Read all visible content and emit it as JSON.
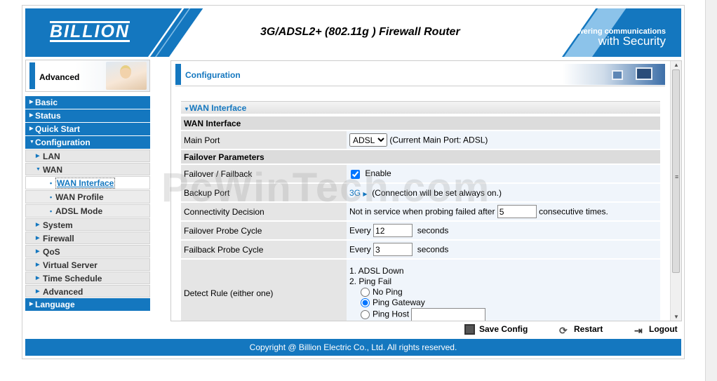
{
  "header": {
    "logo": "BILLION",
    "title": "3G/ADSL2+ (802.11g ) Firewall Router",
    "powering_line1": "Powering communications",
    "powering_line2": "with Security"
  },
  "sidebar": {
    "section_label": "Advanced",
    "items": [
      {
        "label": "Basic",
        "level": "main"
      },
      {
        "label": "Status",
        "level": "main"
      },
      {
        "label": "Quick Start",
        "level": "main"
      },
      {
        "label": "Configuration",
        "level": "main",
        "expanded": true
      },
      {
        "label": "LAN",
        "level": "sub"
      },
      {
        "label": "WAN",
        "level": "sub",
        "expanded": true
      },
      {
        "label": "WAN Interface",
        "level": "sub2",
        "active": true
      },
      {
        "label": "WAN Profile",
        "level": "sub2"
      },
      {
        "label": "ADSL Mode",
        "level": "sub2"
      },
      {
        "label": "System",
        "level": "sub"
      },
      {
        "label": "Firewall",
        "level": "sub"
      },
      {
        "label": "QoS",
        "level": "sub"
      },
      {
        "label": "Virtual Server",
        "level": "sub"
      },
      {
        "label": "Time Schedule",
        "level": "sub"
      },
      {
        "label": "Advanced",
        "level": "sub"
      },
      {
        "label": "Language",
        "level": "main"
      }
    ]
  },
  "content": {
    "header_title": "Configuration",
    "section_title": "WAN Interface",
    "group1_title": "WAN Interface",
    "main_port_label": "Main Port",
    "main_port_value": "ADSL",
    "main_port_note": "(Current Main Port: ADSL)",
    "group2_title": "Failover Parameters",
    "failover_label": "Failover / Failback",
    "failover_enable_label": "Enable",
    "failover_enabled": true,
    "backup_port_label": "Backup Port",
    "backup_port_value": "3G",
    "backup_port_note": "(Connection will be set always on.)",
    "connectivity_label": "Connectivity Decision",
    "connectivity_prefix": "Not in service when probing failed after",
    "connectivity_value": "5",
    "connectivity_suffix": "consecutive times.",
    "failover_probe_label": "Failover Probe Cycle",
    "failover_probe_prefix": "Every",
    "failover_probe_value": "12",
    "failover_probe_suffix": "seconds",
    "failback_probe_label": "Failback Probe Cycle",
    "failback_probe_prefix": "Every",
    "failback_probe_value": "3",
    "failback_probe_suffix": "seconds",
    "detect_rule_label": "Detect Rule (either one)",
    "detect_line1": "1. ADSL Down",
    "detect_line2": "2. Ping Fail",
    "radio_no_ping": "No Ping",
    "radio_ping_gateway": "Ping Gateway",
    "radio_ping_host": "Ping Host",
    "ping_host_value": ""
  },
  "actions": {
    "save": "Save Config",
    "restart": "Restart",
    "logout": "Logout"
  },
  "footer": {
    "copyright": "Copyright @ Billion Electric Co., Ltd. All rights reserved."
  },
  "watermark": "PcWinTech.com",
  "colors": {
    "brand_blue": "#1477bf",
    "row_label_bg": "#e5e5e5",
    "row_value_bg": "#f0f5fb"
  },
  "icons": {
    "save": "floppy-disk-icon",
    "restart": "restart-icon",
    "logout": "logout-icon"
  }
}
